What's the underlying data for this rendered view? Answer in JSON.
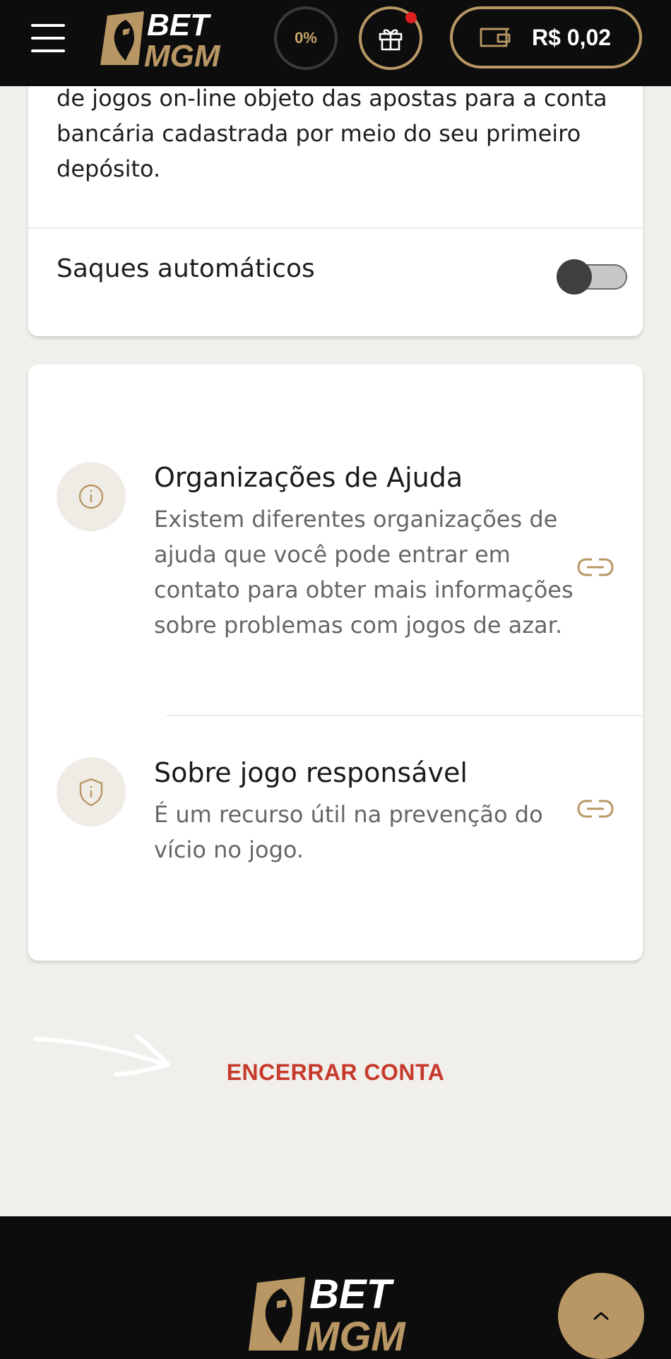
{
  "header": {
    "logo": {
      "line1": "BET",
      "line2": "MGM"
    },
    "progress": "0%",
    "balance": "R$ 0,02"
  },
  "withdrawals": {
    "description": "de jogos on-line objeto das apostas para a conta bancária cadastrada por meio do seu primeiro depósito.",
    "auto_withdraw_label": "Saques automáticos",
    "auto_withdraw_enabled": false
  },
  "help": {
    "items": [
      {
        "title": "Organizações de Ajuda",
        "description": "Existem diferentes organizações de ajuda que você pode entrar em contato para obter mais informações sobre problemas com jogos de azar.",
        "icon": "info-icon"
      },
      {
        "title": "Sobre jogo responsável",
        "description": "É um recurso útil na prevenção do vício no jogo.",
        "icon": "shield-info-icon"
      }
    ]
  },
  "actions": {
    "close_account": "ENCERRAR CONTA"
  },
  "footer": {
    "logo": {
      "line1": "BET",
      "line2": "MGM"
    }
  },
  "colors": {
    "gold": "#b99765",
    "gold_text": "#c7a467",
    "danger": "#c73a2b",
    "background": "#f1efeb",
    "header_bg": "#0d0d0d"
  }
}
